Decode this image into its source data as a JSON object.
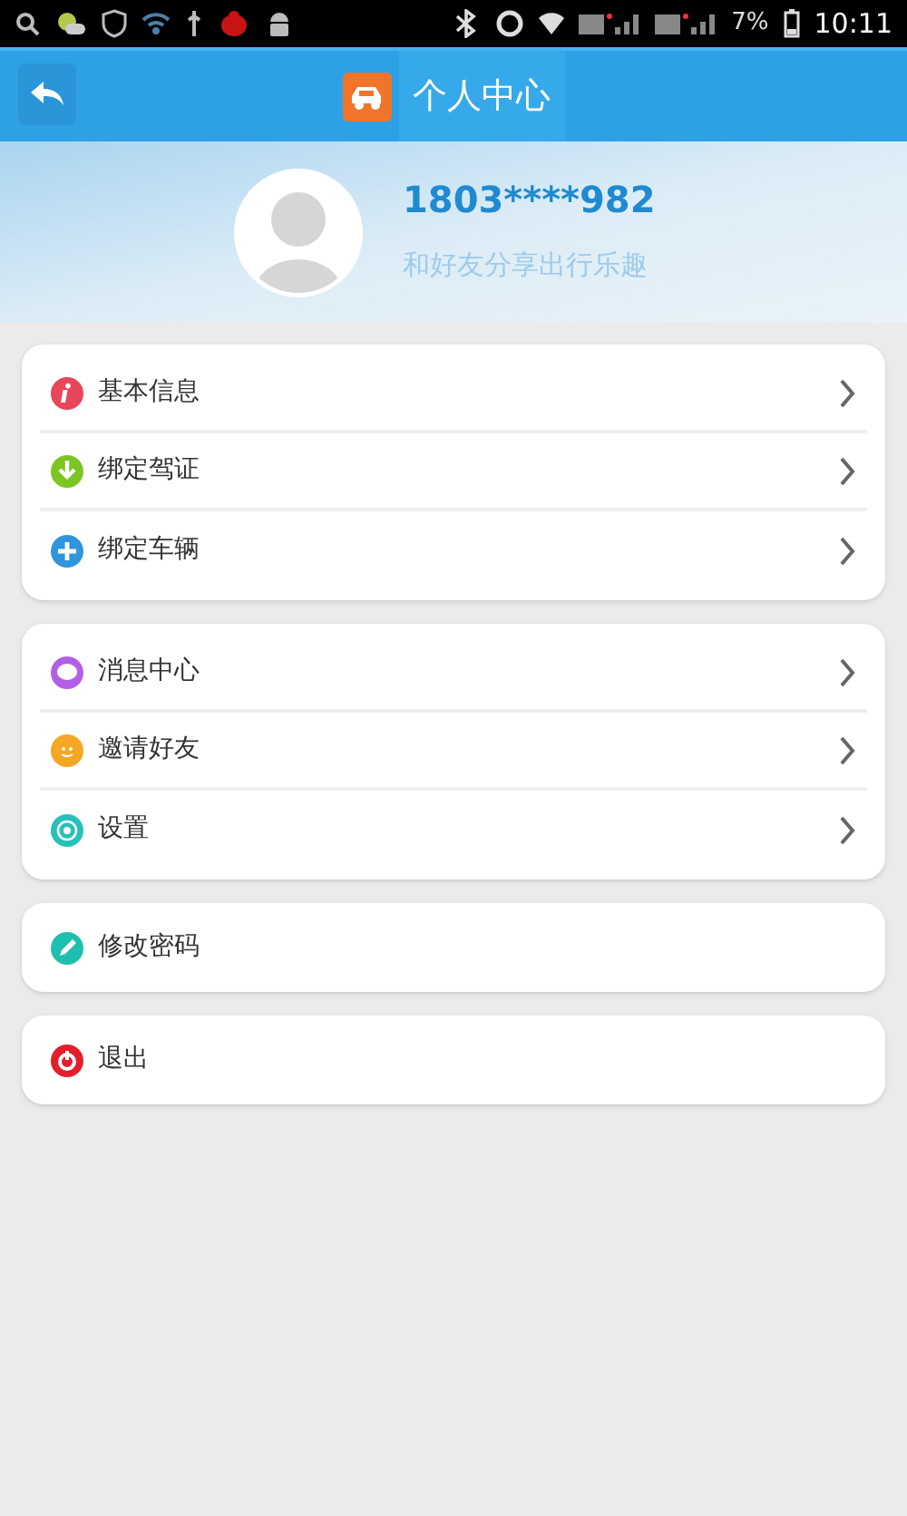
{
  "status_bar": {
    "battery": "7%",
    "time": "10:11"
  },
  "header": {
    "title": "个人中心"
  },
  "profile": {
    "phone": "1803****982",
    "tagline": "和好友分享出行乐趣"
  },
  "groups": [
    [
      {
        "label": "基本信息",
        "kind": "info",
        "color": "#e8465a",
        "arrow": true
      },
      {
        "label": "绑定驾证",
        "kind": "download",
        "color": "#7cc623",
        "arrow": true
      },
      {
        "label": "绑定车辆",
        "kind": "plus",
        "color": "#2f95dc",
        "arrow": true
      }
    ],
    [
      {
        "label": "消息中心",
        "kind": "chat",
        "color": "#b25ee6",
        "arrow": true
      },
      {
        "label": "邀请好友",
        "kind": "smile",
        "color": "#f5a623",
        "arrow": true
      },
      {
        "label": "设置",
        "kind": "gear",
        "color": "#26c1b8",
        "arrow": true
      }
    ],
    [
      {
        "label": "修改密码",
        "kind": "pencil",
        "color": "#1fbfb0",
        "arrow": false
      }
    ],
    [
      {
        "label": "退出",
        "kind": "power",
        "color": "#e41e2a",
        "arrow": false
      }
    ]
  ]
}
